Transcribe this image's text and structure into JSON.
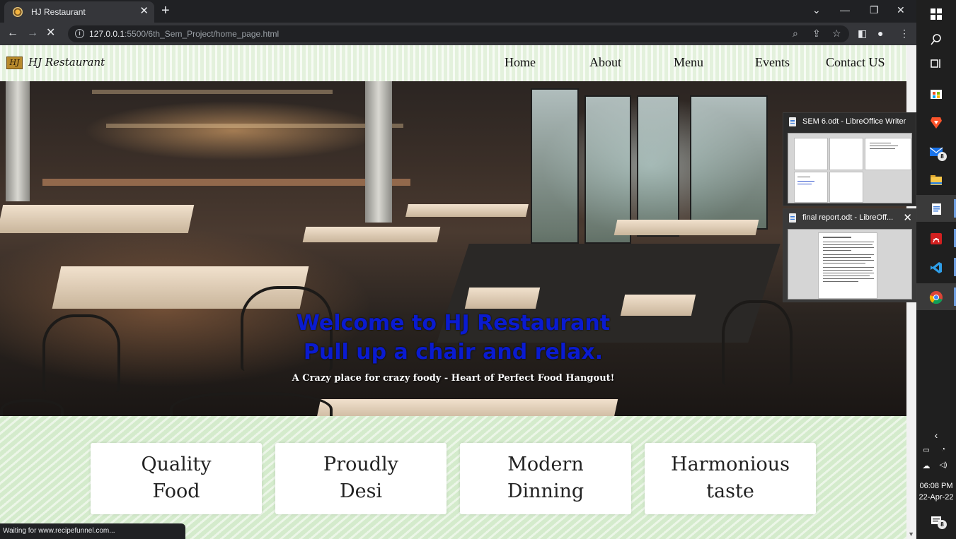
{
  "browser": {
    "tab_title": "HJ Restaurant",
    "tab_close": "✕",
    "new_tab": "+",
    "url_host": "127.0.0.1",
    "url_path": ":5500/6th_Sem_Project/home_page.html",
    "status_text": "Waiting for www.recipefunnel.com..."
  },
  "site": {
    "logo_text": "HJ",
    "brand": "HJ Restaurant",
    "nav": [
      "Home",
      "About",
      "Menu",
      "Events",
      "Contact US"
    ],
    "hero_title_1": "Welcome to HJ Restaurant",
    "hero_title_2": "Pull up a chair and relax.",
    "hero_subtitle": "A Crazy place for crazy foody - Heart of Perfect Food Hangout!",
    "features": [
      {
        "line1": "Quality",
        "line2": "Food"
      },
      {
        "line1": "Proudly",
        "line2": "Desi"
      },
      {
        "line1": "Modern",
        "line2": "Dinning"
      },
      {
        "line1": "Harmonious",
        "line2": "taste"
      }
    ],
    "colors": {
      "hero_title": "#0a1bd0",
      "page_bg": "#d4ebcc"
    }
  },
  "previews": [
    {
      "title": "SEM 6.odt - LibreOffice Writer"
    },
    {
      "title": "final report.odt - LibreOff..."
    }
  ],
  "taskbar": {
    "mail_badge": "8",
    "notif_badge": "8",
    "time": "06:08 PM",
    "date": "22-Apr-22",
    "icons": [
      "windows-icon",
      "search-icon",
      "task-view-icon",
      "store-icon",
      "brave-icon",
      "mail-icon",
      "file-explorer-icon",
      "libreoffice-writer-icon",
      "acrobat-icon",
      "vscode-icon",
      "chrome-icon"
    ]
  }
}
